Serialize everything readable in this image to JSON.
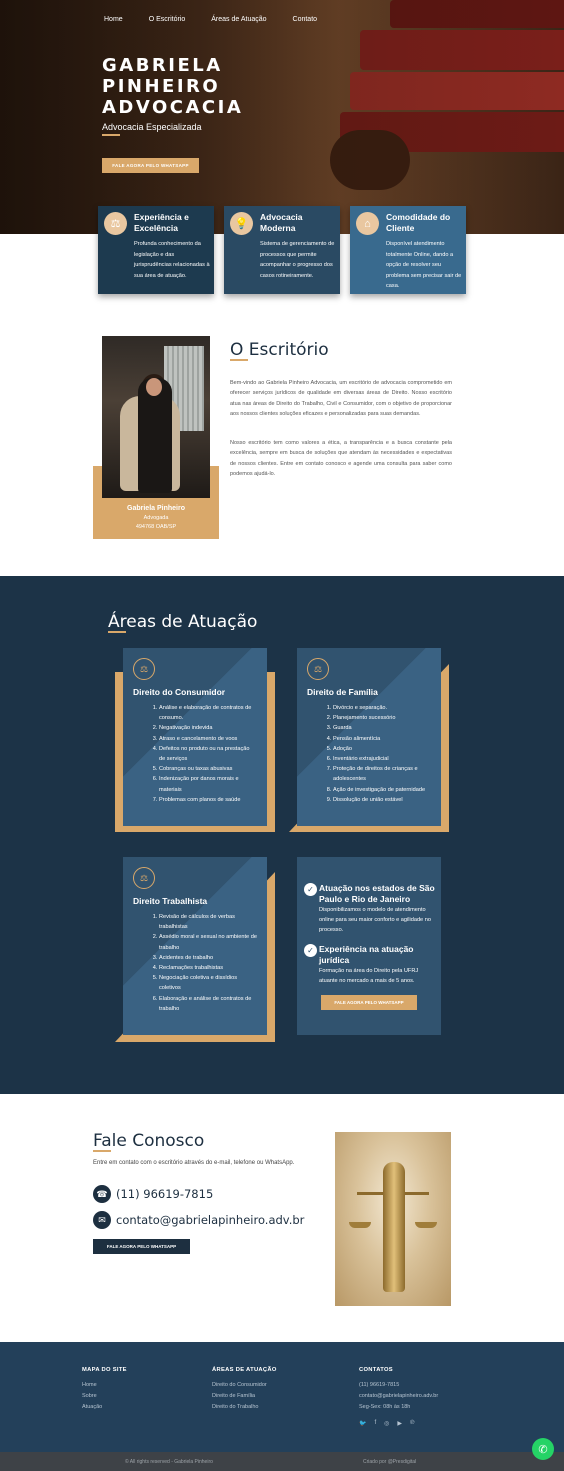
{
  "nav": [
    "Home",
    "O Escritório",
    "Áreas de Atuação",
    "Contato"
  ],
  "hero": {
    "title_lines": [
      "GABRIELA",
      "PINHEIRO",
      "ADVOCACIA"
    ],
    "subtitle": "Advocacia Especializada",
    "button": "FALE AGORA PELO WHATSAPP"
  },
  "features": [
    {
      "icon": "scale-icon",
      "title": "Experiência e Excelência",
      "text": "Profunda conhecimento da legislação e das jurisprudências relacionadas à sua área de atuação."
    },
    {
      "icon": "lightbulb-icon",
      "title": "Advocacia Moderna",
      "text": "Sistema de gerenciamento de processos que permite acompanhar o progresso dos casos rotineiramente."
    },
    {
      "icon": "home-icon",
      "title": "Comodidade do Cliente",
      "text": "Disponível atendimento totalmente Online, dando a opção de resolver seu problema sem precisar sair de casa."
    }
  ],
  "office": {
    "title": "O Escritório",
    "paragraph1": "Bem-vindo ao Gabriela Pinheiro Advocacia, um escritório de advocacia comprometido em oferecer serviços jurídicos de qualidade em diversas áreas de Direito. Nosso escritório atua nas áreas de Direito do Trabalho, Civil e Consumidor, com o objetivo de proporcionar aos nossos clientes soluções eficazes e personalizadas para suas demandas.",
    "paragraph2": "Nosso escritório tem como valores a ética, a transparência e a busca constante pela excelência, sempre em busca de soluções que atendam às necessidades e expectativas de nossos clientes. Entre em contato conosco e agende uma consulta para saber como podemos ajudá-lo.",
    "name": "Gabriela Pinheiro",
    "role": "Advogada",
    "oab": "494768 OAB/SP"
  },
  "areas": {
    "title": "Áreas de Atuação",
    "cards": [
      {
        "title": "Direito do Consumidor",
        "items": [
          "Análise e elaboração de contratos de consumo.",
          "Negativação indevida",
          "Atraso e cancelamento de voos",
          "Defeitos no produto ou na prestação de serviços",
          "Cobranças ou taxas abusivas",
          "Indenização por danos morais e materiais",
          "Problemas com planos de saúde"
        ]
      },
      {
        "title": "Direito de Família",
        "items": [
          "Divórcio e separação.",
          "Planejamento sucessório",
          "Guarda",
          "Pensão alimentícia",
          "Adoção",
          "Inventário extrajudicial",
          "Proteção de direitos de crianças e adolescentes",
          "Ação de investigação de paternidade",
          "Dissolução de união estável"
        ]
      },
      {
        "title": "Direito Trabalhista",
        "items": [
          "Revisão de cálculos de verbas trabalhistas",
          "Assédio moral e sexual no ambiente de trabalho",
          "Acidentes de trabalho",
          "Reclamações trabalhistas",
          "Negociação coletiva e dissídios coletivos",
          "Elaboração e análise de contratos de trabalho"
        ]
      }
    ],
    "info": {
      "h1": "Atuação nos estados de São Paulo e Rio de Janeiro",
      "d1": "Disponibilizamos o modelo de atendimento online para seu maior conforto e agilidade no processo.",
      "h2": "Experiência na atuação jurídica",
      "d2": "Formação na área do Direito pela UFRJ atuante no mercado a mais de 5 anos.",
      "button": "FALE AGORA PELO WHATSAPP"
    }
  },
  "contact": {
    "title": "Fale Conosco",
    "subtitle": "Entre em contato com o escritório através do e-mail, telefone ou WhatsApp.",
    "phone": "(11) 96619-7815",
    "email": "contato@gabrielapinheiro.adv.br",
    "button": "FALE AGORA PELO WHATSAPP"
  },
  "footer": {
    "col1": {
      "title": "MAPA DO SITE",
      "items": [
        "Home",
        "Sobre",
        "Atuação"
      ]
    },
    "col2": {
      "title": "ÁREAS DE ATUAÇÃO",
      "items": [
        "Direito do Consumidor",
        "Direito de Família",
        "Direito do Trabalho"
      ]
    },
    "col3": {
      "title": "CONTATOS",
      "items": [
        "(11) 96619-7815",
        "contato@gabrielapinheiro.adv.br",
        "Seg-Sex: 08h às 18h"
      ]
    },
    "social": [
      "twitter-icon",
      "facebook-icon",
      "instagram-icon",
      "youtube-icon",
      "pinterest-icon"
    ],
    "copyright": "© All rights reserved - Gabriela Pinheiro",
    "credit": "Criado por @Presdigital"
  },
  "colors": {
    "navy": "#1c3347",
    "gold": "#d9a86a",
    "card": "#31536f"
  }
}
